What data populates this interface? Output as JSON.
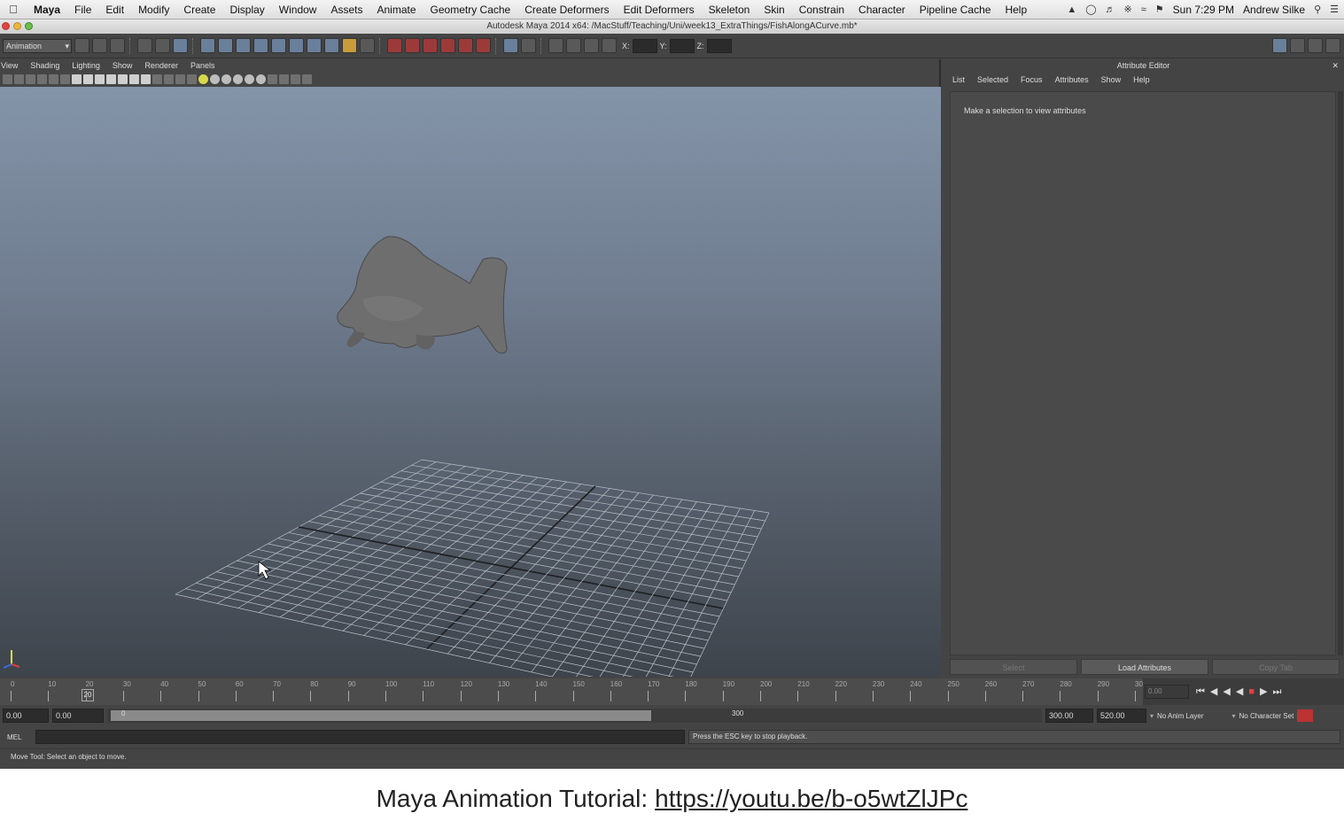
{
  "mac_menu": {
    "items": [
      "Maya",
      "File",
      "Edit",
      "Modify",
      "Create",
      "Display",
      "Window",
      "Assets",
      "Animate",
      "Geometry Cache",
      "Create Deformers",
      "Edit Deformers",
      "Skeleton",
      "Skin",
      "Constrain",
      "Character",
      "Pipeline Cache",
      "Help"
    ],
    "clock": "Sun 7:29 PM",
    "user": "Andrew Silke"
  },
  "window_title": "Autodesk Maya 2014 x64: /MacStuff/Teaching/Uni/week13_ExtraThings/FishAlongACurve.mb*",
  "status_line": {
    "mode": "Animation",
    "x_label": "X:",
    "y_label": "Y:",
    "z_label": "Z:"
  },
  "viewport": {
    "menu": [
      "View",
      "Shading",
      "Lighting",
      "Show",
      "Renderer",
      "Panels"
    ]
  },
  "attribute_editor": {
    "title": "Attribute Editor",
    "menu": [
      "List",
      "Selected",
      "Focus",
      "Attributes",
      "Show",
      "Help"
    ],
    "message": "Make a selection to view attributes",
    "buttons": [
      "Select",
      "Load Attributes",
      "Copy Tab"
    ]
  },
  "time_slider": {
    "ticks": [
      "0",
      "10",
      "20",
      "30",
      "40",
      "50",
      "60",
      "70",
      "80",
      "90",
      "100",
      "110",
      "120",
      "130",
      "140",
      "150",
      "160",
      "170",
      "180",
      "190",
      "200",
      "210",
      "220",
      "230",
      "240",
      "250",
      "260",
      "270",
      "280",
      "290",
      "30"
    ],
    "current_frame": "20",
    "current_field": "0.00"
  },
  "range_slider": {
    "start_time": "0.00",
    "range_start": "0.00",
    "range_start_label": "0",
    "range_end_label": "300",
    "range_end": "300.00",
    "end_time": "520.00",
    "anim_layer": "No Anim Layer",
    "character_set": "No Character Set"
  },
  "command_line": {
    "label": "MEL",
    "result": "Press the ESC key to stop playback."
  },
  "help_line": "Move Tool: Select an object to move.",
  "caption": {
    "text": "Maya Animation Tutorial:",
    "link": "https://youtu.be/b-o5wtZlJPc"
  }
}
